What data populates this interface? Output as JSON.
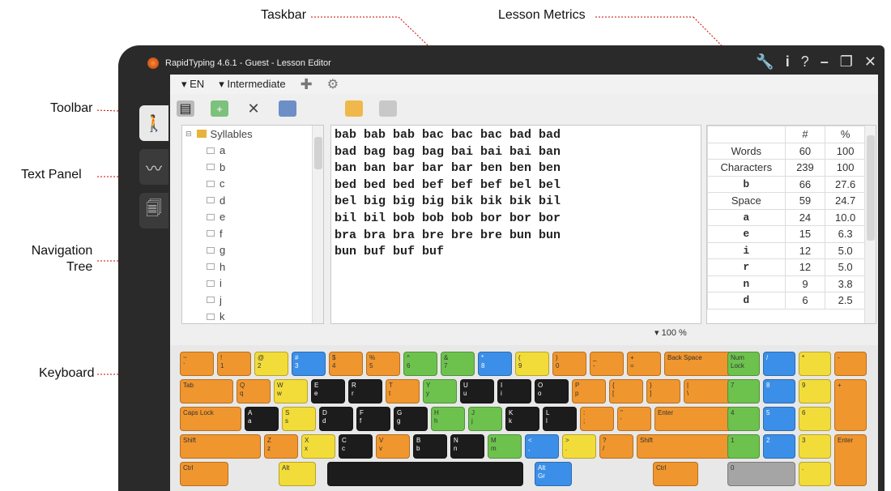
{
  "callouts": {
    "taskbar": "Taskbar",
    "lesson_metrics": "Lesson Metrics",
    "toolbar": "Toolbar",
    "text_panel": "Text Panel",
    "navigation_tree_line1": "Navigation",
    "navigation_tree_line2": "Tree",
    "keyboard": "Keyboard"
  },
  "window": {
    "title": "RapidTyping 4.6.1 - Guest - Lesson Editor",
    "controls": [
      "wrench-icon",
      "info-icon",
      "help-icon",
      "minimize-icon",
      "restore-icon",
      "close-icon"
    ]
  },
  "sidetabs": [
    "walking-man-icon",
    "chart-icon",
    "lesson-editor-icon"
  ],
  "taskbar": {
    "language": "▾ EN",
    "level": "▾ Intermediate"
  },
  "toolbar": [
    "new-icon",
    "add-icon",
    "delete-icon",
    "rename-icon",
    "open-icon",
    "save-icon"
  ],
  "tree": {
    "root": "Syllables",
    "items": [
      "a",
      "b",
      "c",
      "d",
      "e",
      "f",
      "g",
      "h",
      "i",
      "j",
      "k"
    ]
  },
  "text_lines": [
    "bab bab bab bac bac bac bad bad",
    "bad bag bag bag bai bai bai ban",
    "ban ban bar bar bar ben ben ben",
    "bed bed bed bef bef bef bel bel",
    "bel big big big bik bik bik bil",
    "bil bil bob bob bob bor bor bor",
    "bra bra bra bre bre bre bun bun",
    "bun buf buf buf"
  ],
  "zoom": "▾ 100 %",
  "metrics": {
    "headers": [
      "",
      "#",
      "%"
    ],
    "rows": [
      {
        "label": "Words",
        "count": "60",
        "pct": "100"
      },
      {
        "label": "Characters",
        "count": "239",
        "pct": "100"
      },
      {
        "label": "b",
        "count": "66",
        "pct": "27.6"
      },
      {
        "label": "Space",
        "count": "59",
        "pct": "24.7"
      },
      {
        "label": "a",
        "count": "24",
        "pct": "10.0"
      },
      {
        "label": "e",
        "count": "15",
        "pct": "6.3"
      },
      {
        "label": "i",
        "count": "12",
        "pct": "5.0"
      },
      {
        "label": "r",
        "count": "12",
        "pct": "5.0"
      },
      {
        "label": "n",
        "count": "9",
        "pct": "3.8"
      },
      {
        "label": "d",
        "count": "6",
        "pct": "2.5"
      }
    ]
  },
  "keyboard": {
    "row1": [
      {
        "l": "~\n`",
        "c": "or"
      },
      {
        "l": "!\n1",
        "c": "or"
      },
      {
        "l": "@\n2",
        "c": "ye"
      },
      {
        "l": "#\n3",
        "c": "bl"
      },
      {
        "l": "$\n4",
        "c": "or"
      },
      {
        "l": "%\n5",
        "c": "or"
      },
      {
        "l": "^\n6",
        "c": "gr"
      },
      {
        "l": "&\n7",
        "c": "gr"
      },
      {
        "l": "*\n8",
        "c": "bl"
      },
      {
        "l": "(\n9",
        "c": "ye"
      },
      {
        "l": ")\n0",
        "c": "or"
      },
      {
        "l": "_\n-",
        "c": "or"
      },
      {
        "l": "+\n=",
        "c": "or"
      },
      {
        "l": "Back Space",
        "c": "or"
      }
    ],
    "row2": [
      {
        "l": "Tab",
        "c": "or"
      },
      {
        "l": "Q\nq",
        "c": "or"
      },
      {
        "l": "W\nw",
        "c": "ye"
      },
      {
        "l": "E\ne",
        "c": "bk"
      },
      {
        "l": "R\nr",
        "c": "bk"
      },
      {
        "l": "T\nt",
        "c": "or"
      },
      {
        "l": "Y\ny",
        "c": "gr"
      },
      {
        "l": "U\nu",
        "c": "bk"
      },
      {
        "l": "I\ni",
        "c": "bk"
      },
      {
        "l": "O\no",
        "c": "bk"
      },
      {
        "l": "P\np",
        "c": "or"
      },
      {
        "l": "{\n[",
        "c": "or"
      },
      {
        "l": "}\n]",
        "c": "or"
      },
      {
        "l": "|\n\\",
        "c": "or"
      }
    ],
    "row3": [
      {
        "l": "Caps Lock",
        "c": "or"
      },
      {
        "l": "A\na",
        "c": "bk"
      },
      {
        "l": "S\ns",
        "c": "ye"
      },
      {
        "l": "D\nd",
        "c": "bk"
      },
      {
        "l": "F\nf",
        "c": "bk"
      },
      {
        "l": "G\ng",
        "c": "bk"
      },
      {
        "l": "H\nh",
        "c": "gr"
      },
      {
        "l": "J\nj",
        "c": "gr"
      },
      {
        "l": "K\nk",
        "c": "bk"
      },
      {
        "l": "L\nl",
        "c": "bk"
      },
      {
        "l": ":\n;",
        "c": "or"
      },
      {
        "l": "\"\n'",
        "c": "or"
      },
      {
        "l": "Enter",
        "c": "or"
      }
    ],
    "row4": [
      {
        "l": "Shift",
        "c": "or"
      },
      {
        "l": "Z\nz",
        "c": "or"
      },
      {
        "l": "X\nx",
        "c": "ye"
      },
      {
        "l": "C\nc",
        "c": "bk"
      },
      {
        "l": "V\nv",
        "c": "or"
      },
      {
        "l": "B\nb",
        "c": "bk"
      },
      {
        "l": "N\nn",
        "c": "bk"
      },
      {
        "l": "M\nm",
        "c": "gr"
      },
      {
        "l": "<\n,",
        "c": "bl"
      },
      {
        "l": ">\n.",
        "c": "ye"
      },
      {
        "l": "?\n/",
        "c": "or"
      },
      {
        "l": "Shift",
        "c": "or"
      }
    ],
    "row5": [
      {
        "l": "Ctrl",
        "c": "or"
      },
      {
        "l": "Alt",
        "c": "ye"
      },
      {
        "l": "",
        "c": "bk"
      },
      {
        "l": "Alt\nGr",
        "c": "bl"
      },
      {
        "l": "Ctrl",
        "c": "or"
      }
    ],
    "numpad": [
      {
        "l": "Num\nLock",
        "c": "gr"
      },
      {
        "l": "/",
        "c": "bl"
      },
      {
        "l": "*",
        "c": "ye"
      },
      {
        "l": "-",
        "c": "or"
      },
      {
        "l": "7",
        "c": "gr"
      },
      {
        "l": "8",
        "c": "bl"
      },
      {
        "l": "9",
        "c": "ye"
      },
      {
        "l": "+",
        "c": "or"
      },
      {
        "l": "4",
        "c": "gr"
      },
      {
        "l": "5",
        "c": "bl"
      },
      {
        "l": "6",
        "c": "ye"
      },
      {
        "l": "1",
        "c": "gr"
      },
      {
        "l": "2",
        "c": "bl"
      },
      {
        "l": "3",
        "c": "ye"
      },
      {
        "l": "Enter",
        "c": "or"
      },
      {
        "l": "0",
        "c": "gy"
      },
      {
        "l": ".",
        "c": "ye"
      }
    ]
  }
}
